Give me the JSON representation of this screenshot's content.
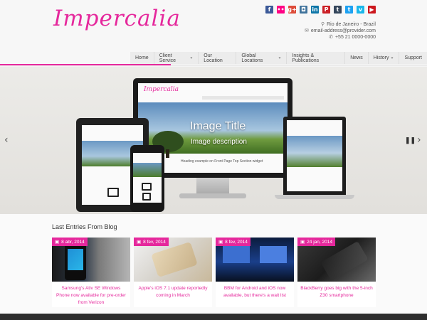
{
  "site": {
    "logo": "Impercalia"
  },
  "social": [
    {
      "icon": "facebook-icon",
      "glyph": "f",
      "color": "#3b5998"
    },
    {
      "icon": "flickr-icon",
      "glyph": "••",
      "color": "#ff0084"
    },
    {
      "icon": "google-plus-icon",
      "glyph": "g+",
      "color": "#dd4b39"
    },
    {
      "icon": "instagram-icon",
      "glyph": "◘",
      "color": "#3f729b"
    },
    {
      "icon": "linkedin-icon",
      "glyph": "in",
      "color": "#0e76a8"
    },
    {
      "icon": "pinterest-icon",
      "glyph": "P",
      "color": "#cb2027"
    },
    {
      "icon": "tumblr-icon",
      "glyph": "t",
      "color": "#35465c"
    },
    {
      "icon": "twitter-icon",
      "glyph": "t",
      "color": "#1da1f2"
    },
    {
      "icon": "vimeo-icon",
      "glyph": "v",
      "color": "#1ab7ea"
    },
    {
      "icon": "youtube-icon",
      "glyph": "▶",
      "color": "#cc181e"
    }
  ],
  "contact": {
    "location": "Rio de Janeiro - Brazil",
    "email": "email-address@provider.com",
    "phone": "+55 21 0000-0000"
  },
  "nav": {
    "items": [
      "Home",
      "Client Service",
      "Our Location",
      "Global Locations",
      "Insights & Publications",
      "News",
      "History",
      "Support"
    ]
  },
  "slider": {
    "image_title": "Image Title",
    "image_description": "Image description",
    "mini_logo": "Impercalia",
    "mini_heading": "Heading example on Front Page Top Section widget"
  },
  "blog": {
    "title": "Last Entries From Blog",
    "posts": [
      {
        "date": "8 abr, 2014",
        "caption": "Samsung's Ativ SE Windows Phone now available for pre-order from Verizon"
      },
      {
        "date": "8 fev, 2014",
        "caption": "Apple's iOS 7.1 update reportedly coming in March"
      },
      {
        "date": "8 fev, 2014",
        "caption": "BBM for Android and iOS now available, but there's a wait list"
      },
      {
        "date": "24 jan, 2014",
        "caption": "BlackBerry goes big with the 5-inch Z30 smartphone"
      }
    ]
  },
  "colors": {
    "accent": "#e5289c",
    "footer": "#2e2e2e"
  }
}
